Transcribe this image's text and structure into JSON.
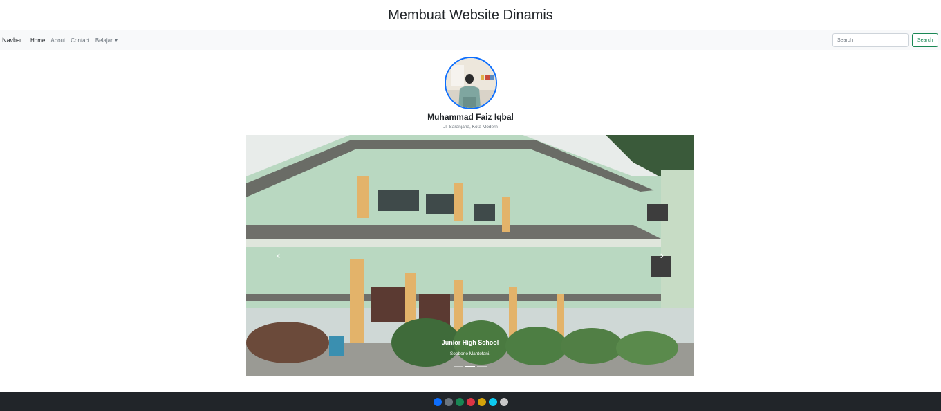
{
  "page": {
    "title": "Membuat Website Dinamis"
  },
  "navbar": {
    "brand": "Navbar",
    "links": [
      {
        "label": "Home",
        "active": true
      },
      {
        "label": "About",
        "active": false
      },
      {
        "label": "Contact",
        "active": false
      },
      {
        "label": "Belajar",
        "active": false,
        "dropdown": true
      }
    ],
    "search": {
      "placeholder": "Search",
      "button_label": "Search"
    }
  },
  "profile": {
    "name": "Muhammad Faiz Iqbal",
    "address": "Jl. Saranjana, Kota Modern"
  },
  "carousel": {
    "slide_title": "Junior High School",
    "slide_text": "Soebono Mantofani.",
    "prev_icon": "‹",
    "next_icon": "›",
    "indicator_count": 3,
    "active_indicator": 1
  },
  "footer": {
    "theme_colors": [
      "#0d6efd",
      "#6c757d",
      "#198754",
      "#dc3545",
      "#d4a30a",
      "#0dcaf0",
      "#c8c8c8"
    ]
  }
}
